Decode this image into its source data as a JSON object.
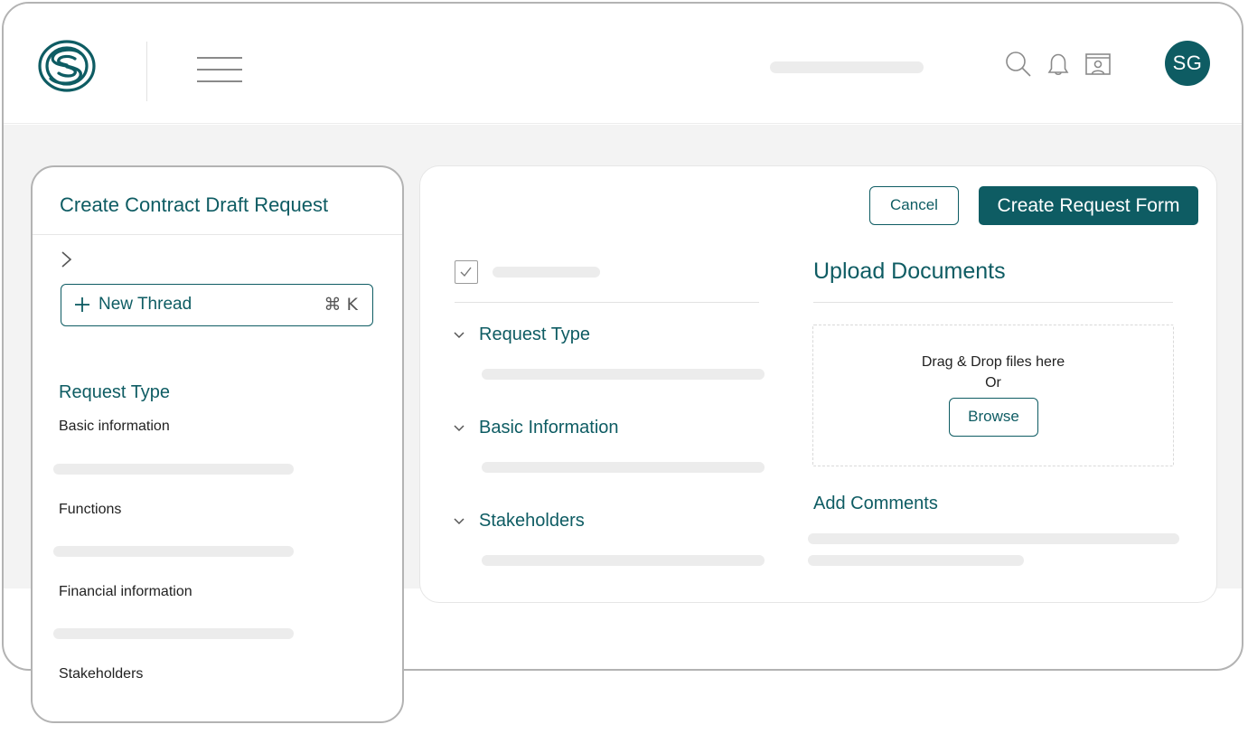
{
  "header": {
    "logo_icon": "coil-s-logo",
    "menu_icon": "hamburger-icon",
    "icons": [
      "search-icon",
      "bell-icon",
      "presentation-icon"
    ],
    "avatar_initials": "SG"
  },
  "sidebar": {
    "title": "Create Contract Draft Request",
    "expand_icon": "chevron-right-icon",
    "new_thread": {
      "label": "New Thread",
      "shortcut": "⌘ K"
    },
    "section_heading": "Request Type",
    "items": [
      {
        "label": "Basic information"
      },
      {
        "label": "Functions"
      },
      {
        "label": "Financial information"
      },
      {
        "label": "Stakeholders"
      }
    ]
  },
  "main": {
    "cancel_label": "Cancel",
    "create_label": "Create Request Form",
    "accordions": [
      {
        "label": "Request Type"
      },
      {
        "label": "Basic Information"
      },
      {
        "label": "Stakeholders"
      }
    ],
    "upload": {
      "title": "Upload Documents",
      "drop_text": "Drag & Drop files here",
      "or_text": "Or",
      "browse_label": "Browse"
    },
    "comments_title": "Add Comments"
  },
  "colors": {
    "accent": "#0e5c63",
    "placeholder": "#ececec",
    "background": "#f3f3f3",
    "border": "#b3b3b3"
  }
}
